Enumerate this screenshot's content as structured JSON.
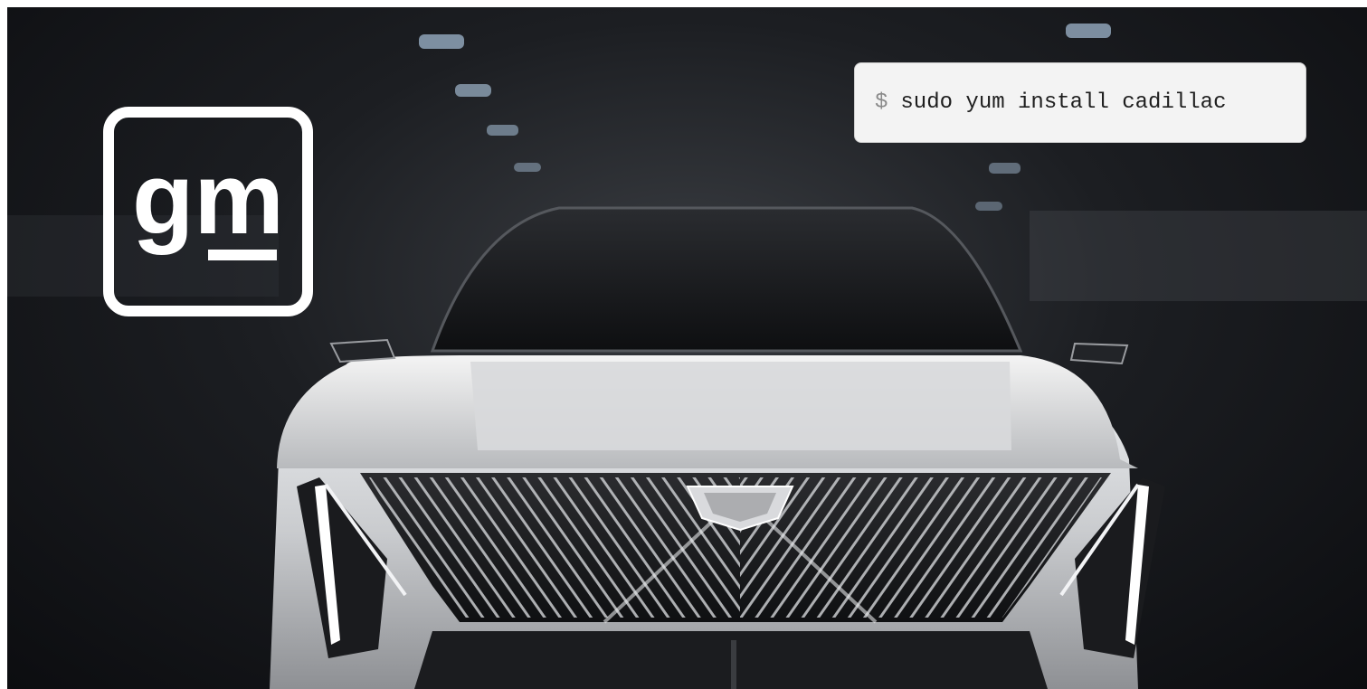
{
  "brand": {
    "logo_text": "gm",
    "logo_color": "#ffffff"
  },
  "terminal": {
    "prompt": "$",
    "command": "sudo yum install cadillac"
  },
  "colors": {
    "background_dark": "#111215",
    "car_body": "#d9dadc",
    "terminal_bg": "#f3f3f3",
    "headlight": "#ffffff"
  }
}
